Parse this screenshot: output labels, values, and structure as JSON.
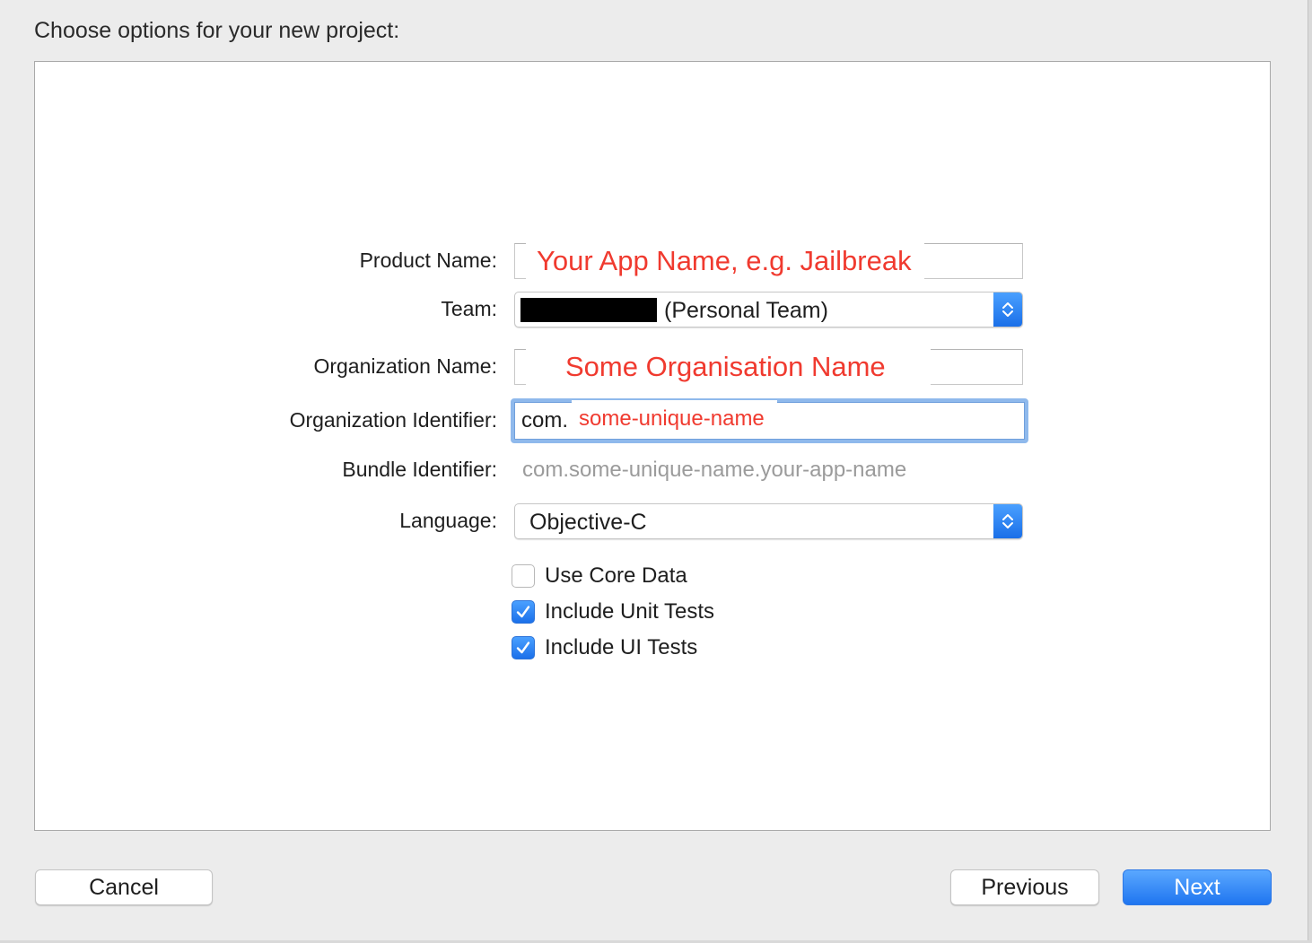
{
  "dialog": {
    "heading": "Choose options for your new project:"
  },
  "form": {
    "product_name": {
      "label": "Product Name:",
      "value": "Your App Name, e.g. Jailbreak"
    },
    "team": {
      "label": "Team:",
      "value": "(Personal Team)"
    },
    "organization_name": {
      "label": "Organization Name:",
      "value": "Some Organisation Name"
    },
    "organization_identifier": {
      "label": "Organization Identifier:",
      "prefix": "com.",
      "value": "some-unique-name"
    },
    "bundle_identifier": {
      "label": "Bundle Identifier:",
      "value": "com.some-unique-name.your-app-name"
    },
    "language": {
      "label": "Language:",
      "value": "Objective-C"
    },
    "options": [
      {
        "label": "Use Core Data",
        "checked": false
      },
      {
        "label": "Include Unit Tests",
        "checked": true
      },
      {
        "label": "Include UI Tests",
        "checked": true
      }
    ]
  },
  "footer": {
    "cancel_label": "Cancel",
    "previous_label": "Previous",
    "next_label": "Next"
  },
  "colors": {
    "accent": "#1f75f0",
    "annotation_red": "#f03a2f",
    "placeholder_gray": "#9b9b9b"
  },
  "icons": {
    "stepper": "chevron-up-down-icon",
    "check": "checkmark-icon"
  }
}
